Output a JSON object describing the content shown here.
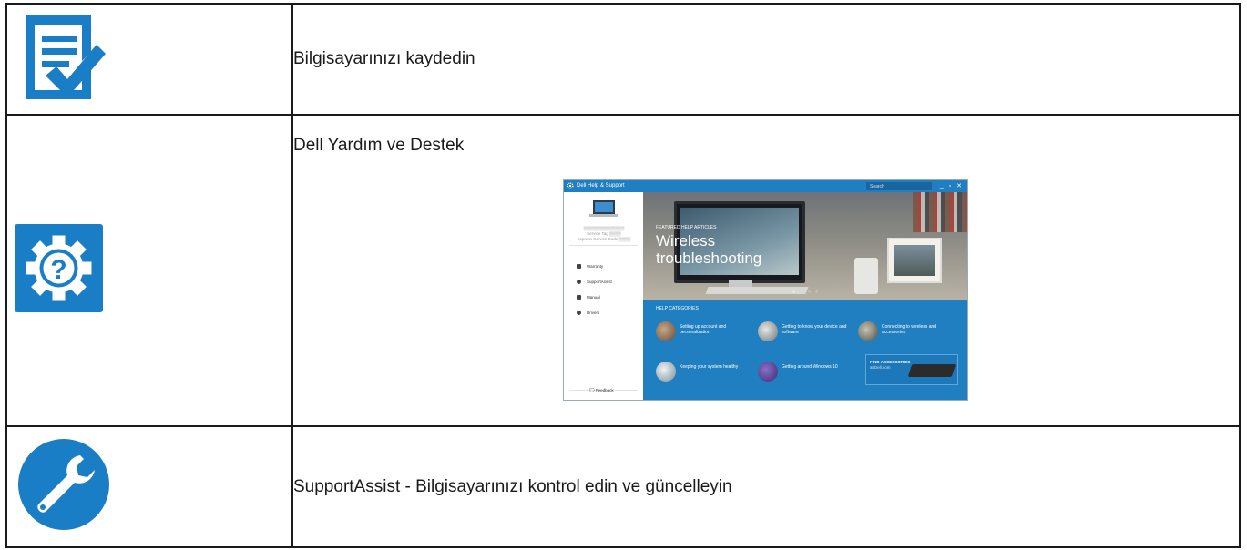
{
  "rows": [
    {
      "text": "Bilgisayarınızı kaydedin",
      "icon": "register-checklist-icon"
    },
    {
      "text": "Dell Yardım ve Destek",
      "icon": "help-gear-icon"
    },
    {
      "text": "SupportAssist - Bilgisayarınızı kontrol edin ve güncelleyin",
      "icon": "wrench-icon"
    }
  ],
  "app": {
    "title": "Dell Help & Support",
    "search_placeholder": "Search",
    "window_controls": "_ ▫ ✕",
    "service_tag": "Service Tag",
    "express_code": "Express Service Code",
    "nav": [
      "Warranty",
      "SupportAssist",
      "Manual",
      "Drivers"
    ],
    "feedback": "Feedback",
    "featured_label": "FEATURED HELP ARTICLES",
    "featured_title_line1": "Wireless",
    "featured_title_line2": "troubleshooting",
    "categories_header": "HELP CATEGORIES",
    "categories": [
      "Setting up account and personalization",
      "Getting to know your device and software",
      "Connecting to wireless and accessories",
      "Keeping your system healthy",
      "Getting around Windows 10"
    ],
    "accessories_title": "FIND ACCESSORIES",
    "accessories_sub": "at Dell.com"
  },
  "colors": {
    "dell_blue": "#1a7ec6",
    "app_blue": "#1f7fc0",
    "border": "#1a1a1a"
  }
}
